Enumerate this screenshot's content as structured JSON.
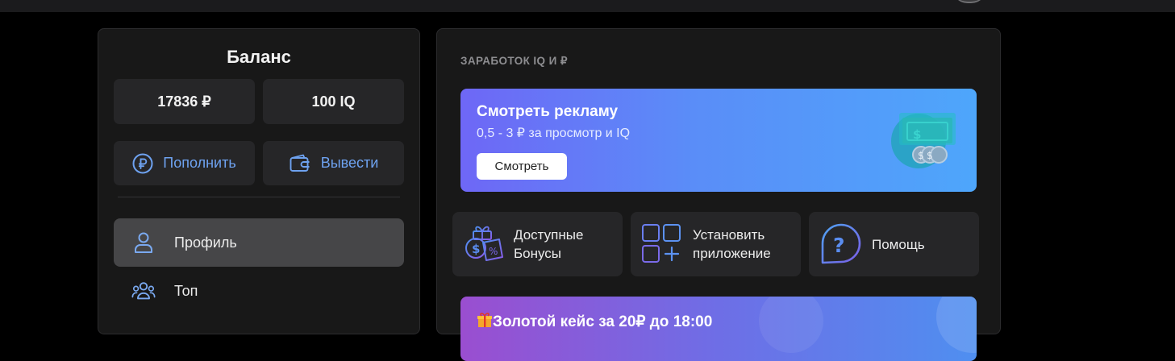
{
  "balance": {
    "title": "Баланс",
    "rub": "17836 ₽",
    "iq": "100 IQ",
    "topup_label": "Пополнить",
    "withdraw_label": "Вывести"
  },
  "menu": {
    "items": [
      {
        "label": "Профиль",
        "icon": "user-icon",
        "active": true
      },
      {
        "label": "Топ",
        "icon": "users-icon",
        "active": false
      }
    ]
  },
  "earn": {
    "section_title": "ЗАРАБОТОК IQ И ₽",
    "ad": {
      "title": "Смотреть рекламу",
      "subtitle": "0,5 - 3 ₽ за просмотр и IQ",
      "button": "Смотреть"
    },
    "tiles": [
      {
        "label_line1": "Доступные",
        "label_line2": "Бонусы",
        "icon": "gift-bonus-icon"
      },
      {
        "label_line1": "Установить",
        "label_line2": "приложение",
        "icon": "apps-add-icon"
      },
      {
        "label_line1": "Помощь",
        "label_line2": "",
        "icon": "help-icon"
      }
    ],
    "gold_case": {
      "title": "Золотой кейс за 20₽ до 18:00",
      "icon": "gift-emoji-icon"
    }
  },
  "colors": {
    "accent": "#6ea2f0",
    "panel": "#181818",
    "box": "#262628",
    "active": "#464648"
  }
}
